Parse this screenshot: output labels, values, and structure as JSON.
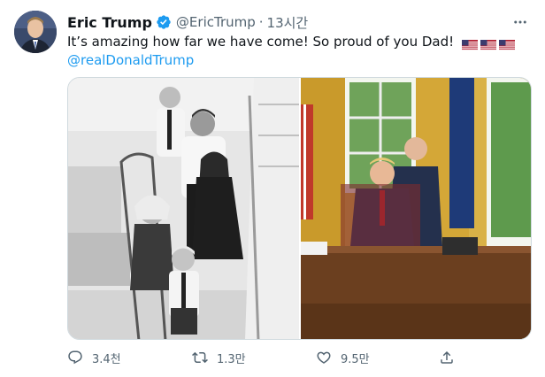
{
  "author": {
    "display_name": "Eric Trump",
    "handle": "@EricTrump",
    "separator": "·",
    "timestamp": "13시간",
    "verified_icon": "verified-badge-icon",
    "avatar_icon": "profile-avatar"
  },
  "tweet": {
    "text": "It’s amazing how far we have come! So proud of you Dad!",
    "flags": [
      "us-flag-icon",
      "us-flag-icon",
      "us-flag-icon"
    ],
    "mention": "@realDonaldTrump"
  },
  "media": {
    "photos": [
      "black-and-white family photo on staircase",
      "color photo in Oval Office"
    ]
  },
  "actions": {
    "reply_count": "3.4천",
    "retweet_count": "1.3만",
    "like_count": "9.5만",
    "reply_icon": "reply-icon",
    "retweet_icon": "retweet-icon",
    "like_icon": "heart-icon",
    "share_icon": "share-icon",
    "more_icon": "more-icon"
  },
  "colors": {
    "accent": "#1d9bf0",
    "secondary_text": "#536471",
    "primary_text": "#0f1419"
  }
}
